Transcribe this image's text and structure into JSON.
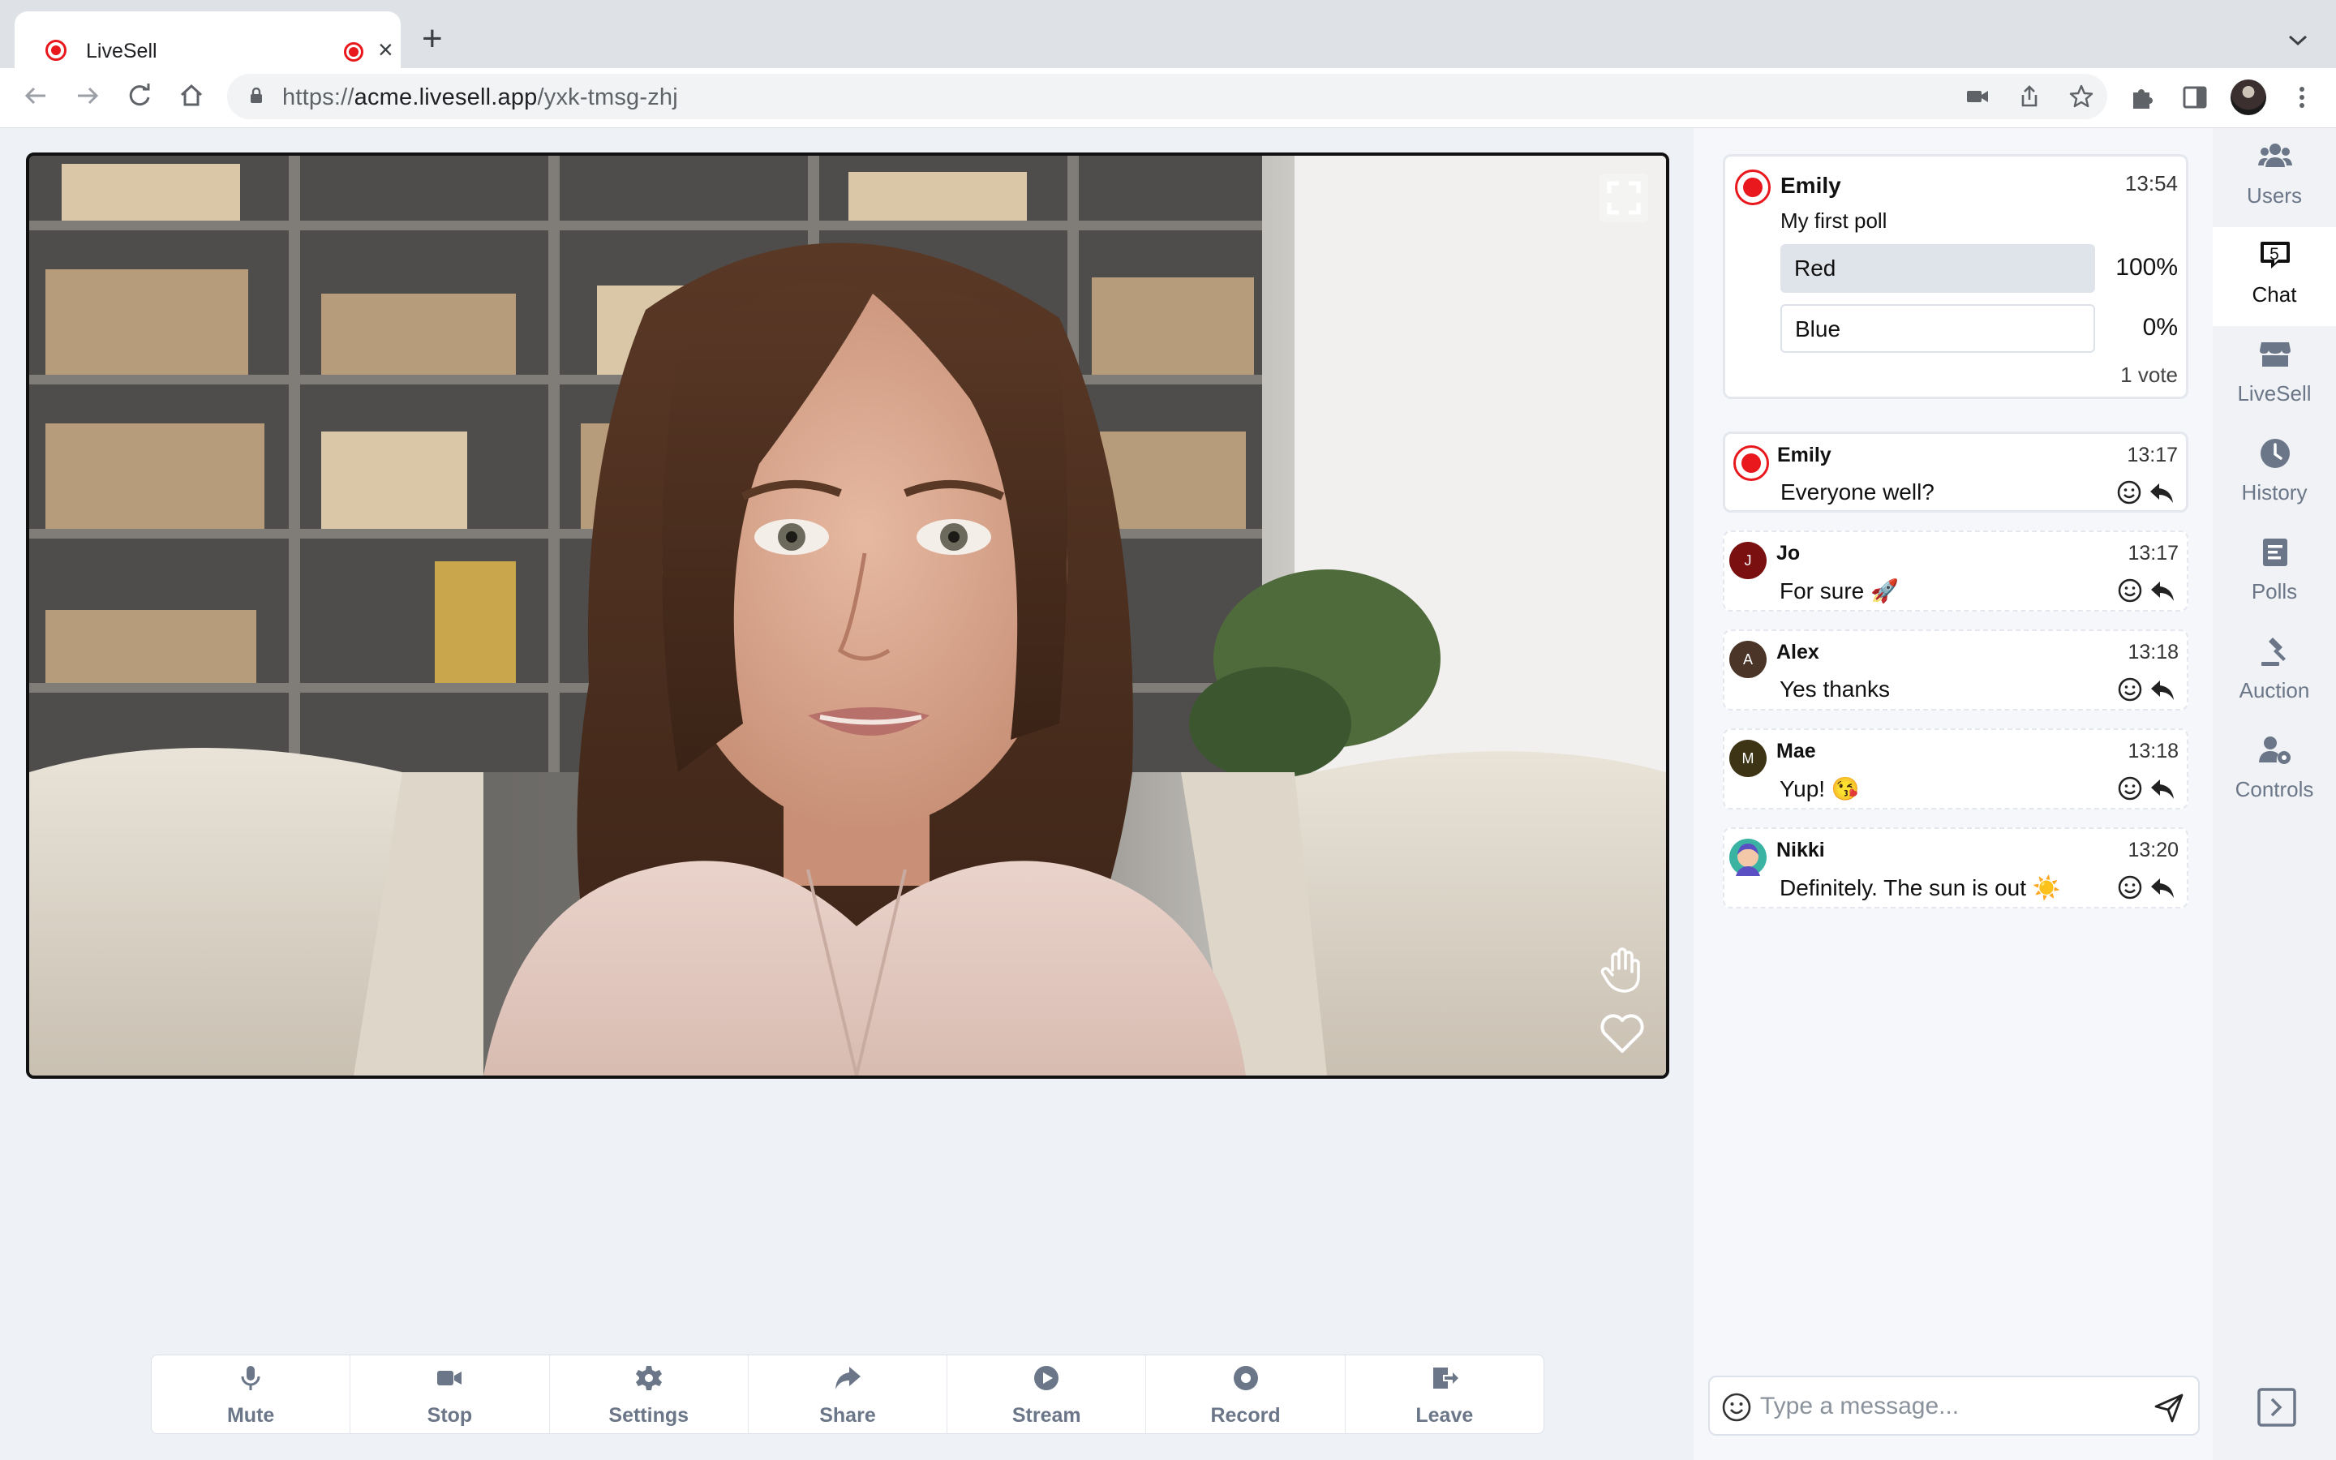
{
  "browser": {
    "tab_title": "LiveSell",
    "url_scheme": "https://",
    "url_host": "acme.livesell.app",
    "url_path": "/yxk-tmsg-zhj"
  },
  "controls": [
    {
      "label": "Mute",
      "icon": "mic-icon"
    },
    {
      "label": "Stop",
      "icon": "camera-icon"
    },
    {
      "label": "Settings",
      "icon": "gear-icon"
    },
    {
      "label": "Share",
      "icon": "share-icon"
    },
    {
      "label": "Stream",
      "icon": "play-icon"
    },
    {
      "label": "Record",
      "icon": "record-icon"
    },
    {
      "label": "Leave",
      "icon": "leave-icon"
    }
  ],
  "poll": {
    "author": "Emily",
    "time": "13:54",
    "question": "My first poll",
    "options": [
      {
        "label": "Red",
        "percent": "100%"
      },
      {
        "label": "Blue",
        "percent": "0%"
      }
    ],
    "votes": "1 vote"
  },
  "messages": [
    {
      "user": "Emily",
      "time": "13:17",
      "text": "Everyone well?",
      "avatar": "record-icon"
    },
    {
      "user": "Jo",
      "time": "13:17",
      "text": "For sure 🚀",
      "initial": "J",
      "color": "#7a1010"
    },
    {
      "user": "Alex",
      "time": "13:18",
      "text": "Yes thanks",
      "initial": "A",
      "color": "#4a3528"
    },
    {
      "user": "Mae",
      "time": "13:18",
      "text": "Yup! 😘",
      "initial": "M",
      "color": "#3d3416"
    },
    {
      "user": "Nikki",
      "time": "13:20",
      "text": "Definitely. The sun is out ☀️",
      "avatar": "cartoon-avatar"
    }
  ],
  "composer": {
    "placeholder": "Type a message..."
  },
  "sidebar": {
    "items": [
      {
        "label": "Users",
        "icon": "users-icon"
      },
      {
        "label": "Chat",
        "icon": "chat-icon",
        "badge": "5",
        "active": true
      },
      {
        "label": "LiveSell",
        "icon": "store-icon"
      },
      {
        "label": "History",
        "icon": "clock-icon"
      },
      {
        "label": "Polls",
        "icon": "poll-icon"
      },
      {
        "label": "Auction",
        "icon": "gavel-icon"
      },
      {
        "label": "Controls",
        "icon": "user-cog-icon"
      }
    ]
  },
  "colors": {
    "accent_red": "#e8181d",
    "muted": "#6b7788",
    "panel": "#f5f7fa",
    "stage": "#eef1f5"
  }
}
